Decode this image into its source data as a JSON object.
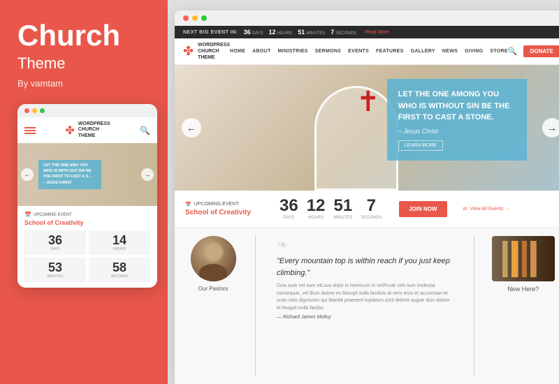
{
  "left": {
    "title": "Church",
    "subtitle": "Theme",
    "author": "By vamtam",
    "dots": [
      "red",
      "yellow",
      "green"
    ],
    "mobile_logo": "WORDPRESS\nCHURCH\nTHEME",
    "mobile_event_label": "UPCOMING EVENT:",
    "mobile_event_name": "School of Creativity",
    "mobile_countdown": [
      {
        "num": "36",
        "label": "DAYS"
      },
      {
        "num": "14",
        "label": "HOURS"
      },
      {
        "num": "53",
        "label": "MINUTES"
      },
      {
        "num": "58",
        "label": "SECONDS"
      }
    ],
    "mobile_hero_text": "LET THE ONE AMO YOU WHO IS WITH OUT SIN BE THE FIRST TO CAST A S...",
    "mobile_hero_attr": "~ Jesus Christ"
  },
  "right": {
    "browser_dots": [
      "red",
      "yellow",
      "green"
    ],
    "event_bar": {
      "label": "NEXT BIG EVENT IN:",
      "days": {
        "num": "36",
        "unit": "DAYS"
      },
      "hours": {
        "num": "12",
        "unit": "HOURS"
      },
      "minutes": {
        "num": "51",
        "unit": "MINUTES"
      },
      "seconds": {
        "num": "7",
        "unit": "SECONDS"
      },
      "read_more": "Read More"
    },
    "nav": {
      "logo_text": "WORDPRESS\nCHURCH\nTHEME",
      "links": [
        "HOME",
        "ABOUT",
        "MINISTRIES",
        "SERMONS",
        "EVENTS",
        "FEATURES",
        "GALLERY",
        "NEWS",
        "GIVING",
        "STORE"
      ],
      "donate_label": "Donate"
    },
    "hero": {
      "quote": "LET THE ONE AMONG YOU WHO IS WITHOUT SIN BE THE FIRST TO CAST A STONE.",
      "attribution": "~ Jesus Christ",
      "btn_label": "LEARN MORE"
    },
    "countdown": {
      "event_label": "UPCOMING EVENT:",
      "event_name": "School of Creativity",
      "days": {
        "num": "36",
        "unit": "DAYS"
      },
      "hours": {
        "num": "12",
        "unit": "HOURS"
      },
      "minutes": {
        "num": "51",
        "unit": "MINUTES"
      },
      "seconds": {
        "num": "7",
        "unit": "SECONDS"
      },
      "join_label": "Join now",
      "or_text": "or",
      "view_all": "View All Events →"
    },
    "content": {
      "quote": "\"Every mountain top is within reach if you just keep climbing.\"",
      "quote_body": "Duis aute vel sum eILsus dolor in henricum in veIPcute velt num molestia consequat, vel illum dolore ex blanqd nulla facilisis at vero eros et accumsan et iusto odio dignissim qui blandit praesent luptatum zzril delenit augue duis dolore te feugait nulla facilisi.",
      "quote_author": "— Richard James Molloy",
      "pastor_label": "Our Pastors",
      "new_here_label": "New Here?"
    }
  }
}
